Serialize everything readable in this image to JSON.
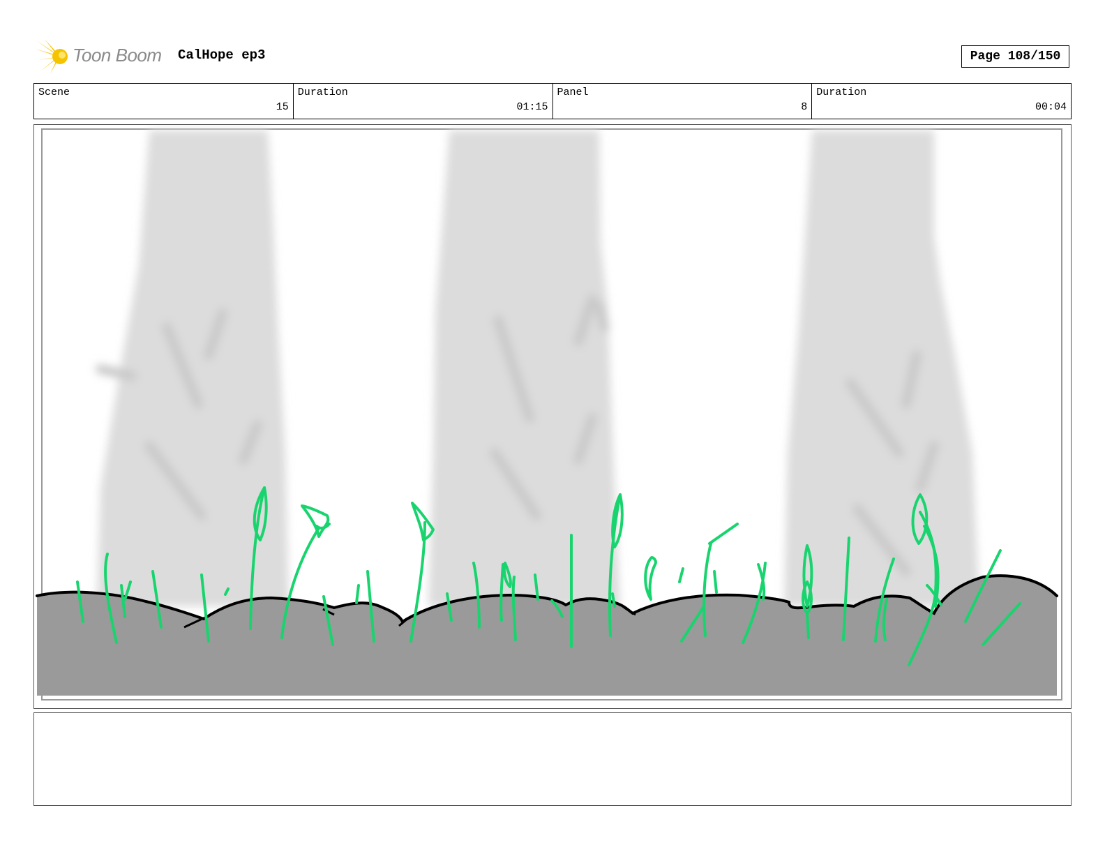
{
  "header": {
    "logo_text": "Toon Boom",
    "project_title": "CalHope ep3",
    "page_label": "Page 108/150"
  },
  "info": {
    "scene_label": "Scene",
    "scene_value": "15",
    "scene_duration_label": "Duration",
    "scene_duration_value": "01:15",
    "panel_label": "Panel",
    "panel_value": "8",
    "panel_duration_label": "Duration",
    "panel_duration_value": "00:04"
  },
  "colors": {
    "logo_accent": "#f5c400",
    "grass": "#19d46e",
    "ground": "#9a9a9a",
    "trunk": "#dcdcdc"
  },
  "notes": {
    "text": ""
  }
}
